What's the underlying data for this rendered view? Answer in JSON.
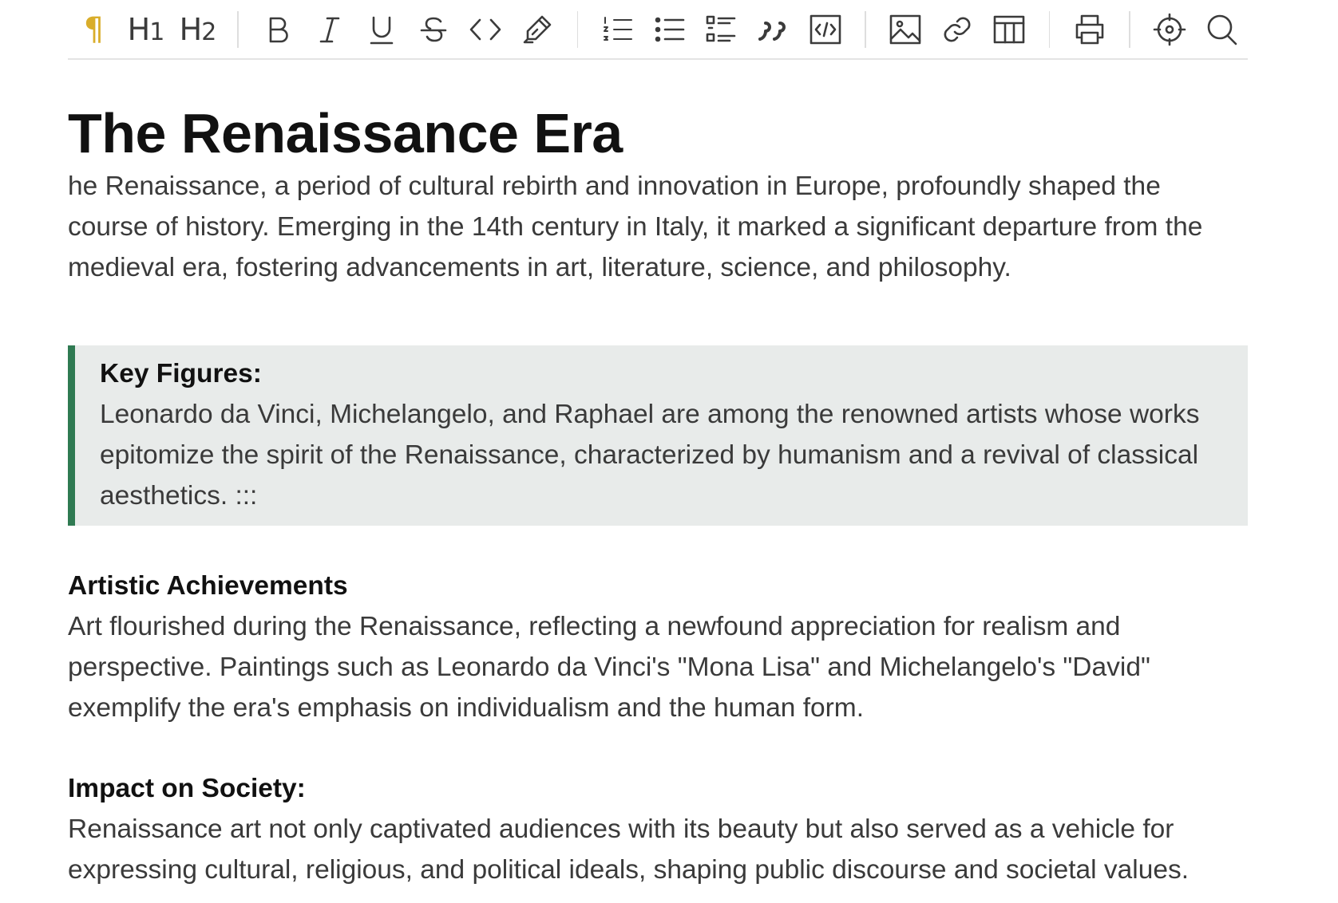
{
  "toolbar": {
    "groups": [
      [
        {
          "name": "paragraph-icon",
          "active": true
        },
        {
          "name": "heading1-icon",
          "label": "H",
          "sub": "1"
        },
        {
          "name": "heading2-icon",
          "label": "H",
          "sub": "2"
        }
      ],
      [
        {
          "name": "bold-icon"
        },
        {
          "name": "italic-icon"
        },
        {
          "name": "underline-icon"
        },
        {
          "name": "strikethrough-icon"
        },
        {
          "name": "code-icon"
        },
        {
          "name": "highlighter-icon"
        }
      ],
      [
        {
          "name": "ordered-list-icon"
        },
        {
          "name": "bullet-list-icon"
        },
        {
          "name": "task-list-icon"
        },
        {
          "name": "blockquote-icon"
        },
        {
          "name": "code-block-icon"
        }
      ],
      [
        {
          "name": "image-icon"
        },
        {
          "name": "link-icon"
        },
        {
          "name": "table-icon"
        }
      ],
      [
        {
          "name": "print-icon"
        }
      ],
      [
        {
          "name": "focus-icon"
        },
        {
          "name": "search-icon"
        }
      ]
    ],
    "active_color": "#d9ad2a"
  },
  "document": {
    "title": "The Renaissance Era",
    "intro": "he Renaissance, a period of cultural rebirth and innovation in Europe, profoundly shaped the course of history. Emerging in the 14th century in Italy, it marked a significant departure from the medieval era, fostering advancements in art, literature, science, and philosophy.",
    "callout": {
      "title": "Key Figures:",
      "text": "Leonardo da Vinci, Michelangelo, and Raphael are among the renowned artists whose works epitomize the spirit of the Renaissance, characterized by humanism and a revival of classical aesthetics. :::",
      "accent": "#2f7a52",
      "background": "#e8ebea"
    },
    "sections": [
      {
        "heading": "Artistic Achievements",
        "text": "Art flourished during the Renaissance, reflecting a newfound appreciation for realism and perspective. Paintings such as Leonardo da Vinci's \"Mona Lisa\" and Michelangelo's \"David\" exemplify the era's emphasis on individualism and the human form."
      },
      {
        "heading": "Impact on Society:",
        "text": "Renaissance art not only captivated audiences with its beauty but also served as a vehicle for expressing cultural, religious, and political ideals, shaping public discourse and societal values."
      }
    ]
  }
}
